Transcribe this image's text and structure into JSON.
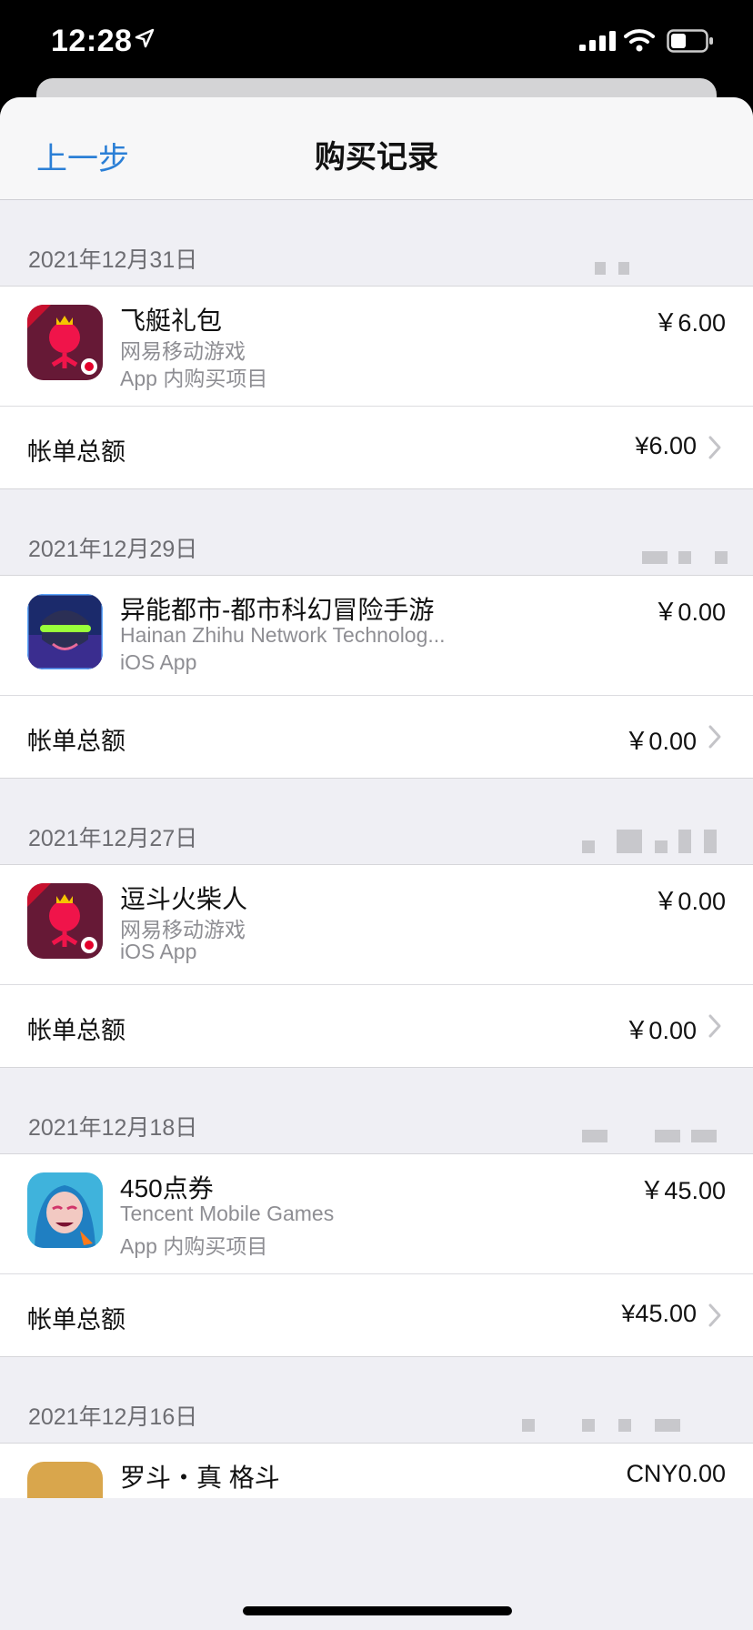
{
  "status": {
    "time": "12:28"
  },
  "nav": {
    "back_label": "上一步",
    "title": "购买记录"
  },
  "sections": [
    {
      "date": "2021年12月31日",
      "item": {
        "name": "飞艇礼包",
        "developer": "网易移动游戏",
        "type": "App 内购买项目",
        "price": "￥6.00",
        "icon": "stickman-red-icon"
      },
      "total_label": "帐单总额",
      "total": "¥6.00"
    },
    {
      "date": "2021年12月29日",
      "item": {
        "name": "异能都市-都市科幻冒险手游",
        "developer": "Hainan Zhihu Network Technolog...",
        "type": "iOS App",
        "price": "￥0.00",
        "icon": "cyber-hero-icon"
      },
      "total_label": "帐单总额",
      "total": "￥0.00"
    },
    {
      "date": "2021年12月27日",
      "item": {
        "name": "逗斗火柴人",
        "developer": "网易移动游戏",
        "type": "iOS App",
        "price": "￥0.00",
        "icon": "stickman-red-icon"
      },
      "total_label": "帐单总额",
      "total": "￥0.00"
    },
    {
      "date": "2021年12月18日",
      "item": {
        "name": "450点券",
        "developer": "Tencent Mobile Games",
        "type": "App 内购买项目",
        "price": "￥45.00",
        "icon": "jinx-icon"
      },
      "total_label": "帐单总额",
      "total": "¥45.00"
    },
    {
      "date": "2021年12月16日",
      "item": {
        "name": "罗斗・真 格斗",
        "price": "CNY0.00"
      }
    }
  ],
  "colors": {
    "accent": "#2b7fd6",
    "background": "#efeff4"
  }
}
